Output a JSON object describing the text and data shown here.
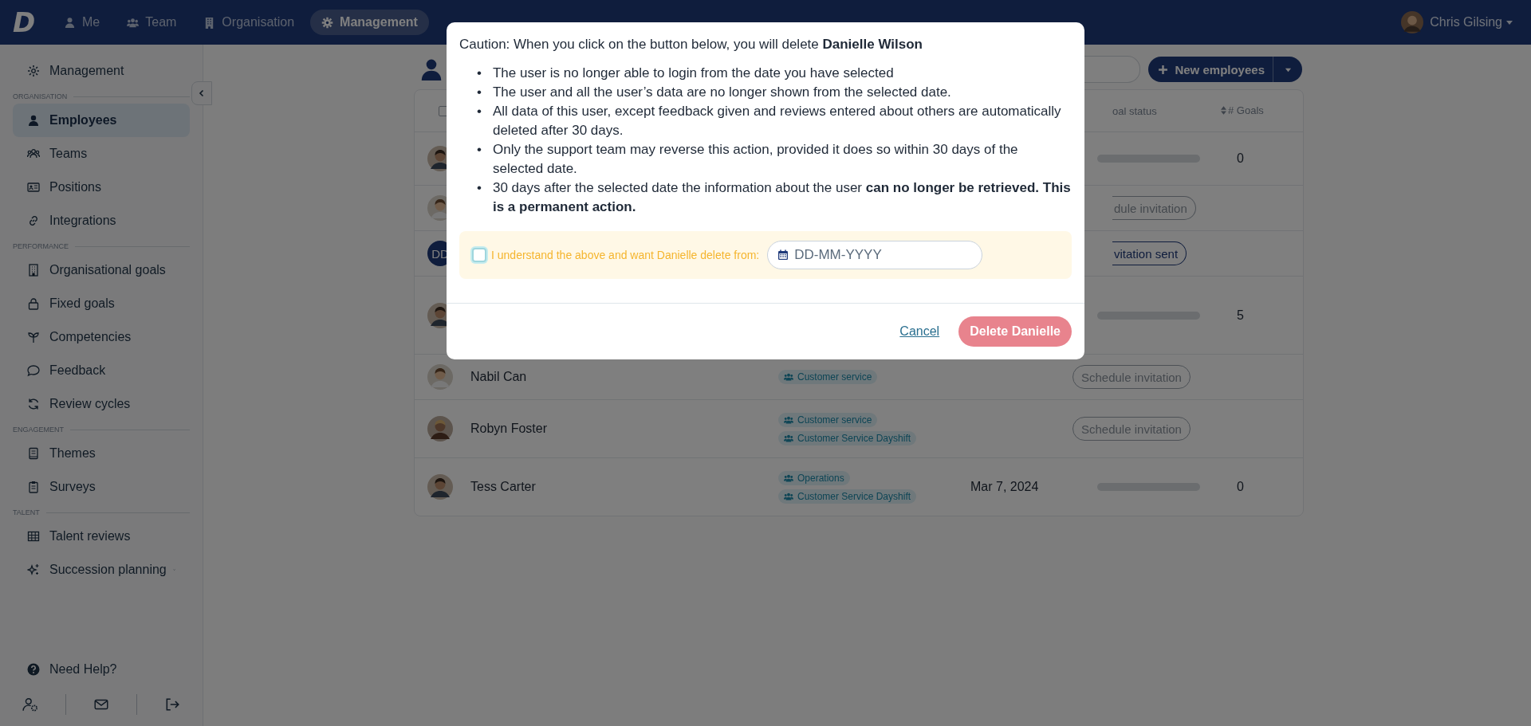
{
  "topbar": {
    "logo": "D",
    "nav": [
      {
        "label": "Me",
        "selected": false
      },
      {
        "label": "Team",
        "selected": false
      },
      {
        "label": "Organisation",
        "selected": false
      },
      {
        "label": "Management",
        "selected": true
      }
    ],
    "user": {
      "name": "Chris Gilsing"
    }
  },
  "sidebar": {
    "top_item": {
      "label": "Management",
      "selected": false
    },
    "sections": [
      {
        "title": "ORGANISATION",
        "items": [
          {
            "label": "Employees",
            "selected": true
          },
          {
            "label": "Teams",
            "selected": false
          },
          {
            "label": "Positions",
            "selected": false
          },
          {
            "label": "Integrations",
            "selected": false
          }
        ]
      },
      {
        "title": "PERFORMANCE",
        "items": [
          {
            "label": "Organisational goals",
            "selected": false
          },
          {
            "label": "Fixed goals",
            "selected": false
          },
          {
            "label": "Competencies",
            "selected": false
          },
          {
            "label": "Feedback",
            "selected": false
          },
          {
            "label": "Review cycles",
            "selected": false
          }
        ]
      },
      {
        "title": "ENGAGEMENT",
        "items": [
          {
            "label": "Themes",
            "selected": false
          },
          {
            "label": "Surveys",
            "selected": false
          }
        ]
      },
      {
        "title": "TALENT",
        "items": [
          {
            "label": "Talent reviews",
            "selected": false
          },
          {
            "label": "Succession planning",
            "selected": false,
            "expanded": false
          }
        ]
      }
    ],
    "help": "Need Help?"
  },
  "page": {
    "new_button": "New employees"
  },
  "table": {
    "select_all": {
      "checked": false
    },
    "columns": [
      "oal status",
      "# Goals"
    ],
    "rows": [
      {
        "level": 0,
        "goals": "0"
      },
      {
        "invitation": {
          "label": "dule invitation",
          "sent": false
        }
      },
      {
        "initials": "DD",
        "invitation": {
          "label": "vitation sent",
          "sent": true
        }
      },
      {
        "level": 0,
        "goals": "5"
      },
      {
        "name": "Nabil Can",
        "teams": [
          "Customer service"
        ],
        "invitation": {
          "label": "Schedule invitation",
          "sent": false
        }
      },
      {
        "name": "Robyn Foster",
        "teams": [
          "Customer service",
          "Customer Service Dayshift"
        ],
        "invitation": {
          "label": "Schedule invitation",
          "sent": false
        }
      },
      {
        "name": "Tess Carter",
        "teams": [
          "Operations",
          "Customer Service Dayshift"
        ],
        "date": "Mar 7, 2024",
        "level": 0,
        "goals": "0"
      }
    ]
  },
  "dialog": {
    "caution": "Caution: When you click on the button below, you will delete **Danielle Wilson**",
    "bullets": [
      {
        "marker": "•",
        "text": "The user is no longer able to login from the date you have selected"
      },
      {
        "marker": "•",
        "text": "The user and all the user’s data are no longer shown from the selected date."
      },
      {
        "marker": "•",
        "text": "All data of this user, except feedback given and reviews entered about others are automatically deleted after 30 days."
      },
      {
        "marker": "•",
        "text": "Only the support team may reverse this action, provided it does so within 30 days of the selected date."
      },
      {
        "marker": "•",
        "text": "30 days after the selected date the information about the user **can no longer be retrieved. This is a permanent action.**"
      }
    ],
    "confirm": {
      "label": "I understand the above and want Danielle delete from:",
      "checked": false
    },
    "date_field": {
      "placeholder": "DD-MM-YYYY"
    },
    "cancel": "Cancel",
    "delete": {
      "label": "Delete Danielle",
      "disabled": true
    }
  }
}
